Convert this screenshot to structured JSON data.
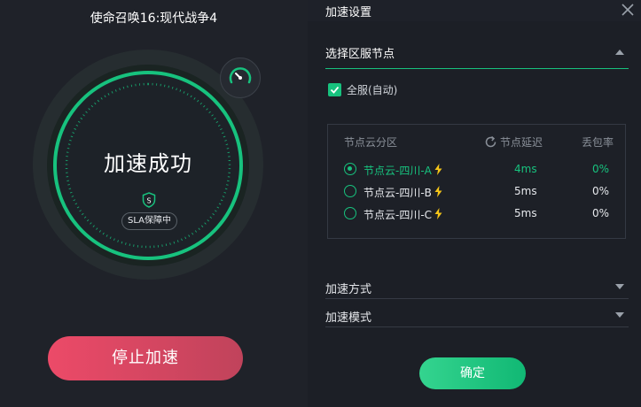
{
  "left": {
    "game_title": "使命召唤16:现代战争4",
    "status": "加速成功",
    "sla_badge": "SLA保障中",
    "shield_glyph": "S",
    "stop_button": "停止加速"
  },
  "right": {
    "title": "加速设置",
    "region_select": {
      "label": "选择区服节点",
      "expanded": true
    },
    "all_servers": {
      "label": "全服(自动)",
      "checked": true
    },
    "node_table": {
      "headers": {
        "name": "节点云分区",
        "delay": "节点延迟",
        "loss": "丢包率"
      },
      "rows": [
        {
          "name": "节点云-四川-A",
          "delay": "4ms",
          "loss": "0%",
          "selected": true
        },
        {
          "name": "节点云-四川-B",
          "delay": "5ms",
          "loss": "0%",
          "selected": false
        },
        {
          "name": "节点云-四川-C",
          "delay": "5ms",
          "loss": "0%",
          "selected": false
        }
      ]
    },
    "accel_method": {
      "label": "加速方式"
    },
    "accel_mode": {
      "label": "加速模式"
    },
    "confirm_button": "确定"
  },
  "colors": {
    "accent_green": "#17c27e",
    "stop_red": "#ec4a68",
    "bolt_yellow": "#f5c518",
    "background": "#1e2129"
  },
  "icons": [
    "speedometer-icon",
    "shield-icon",
    "close-icon",
    "refresh-icon",
    "lightning-icon",
    "check-icon",
    "chevron-up-icon",
    "chevron-down-icon"
  ]
}
